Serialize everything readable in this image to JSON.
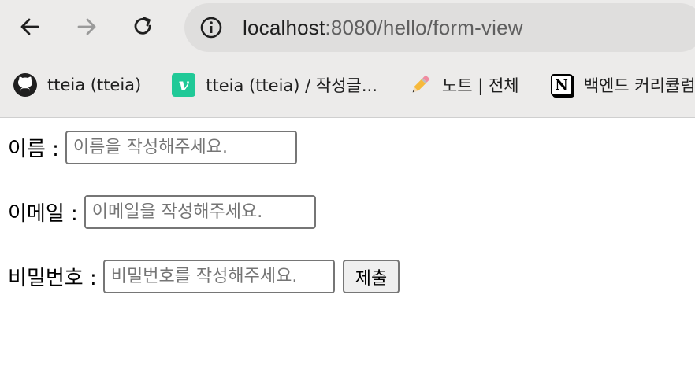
{
  "browser": {
    "url_host": "localhost",
    "url_path": ":8080/hello/form-view",
    "bookmarks": [
      {
        "label": "tteia (tteia)",
        "icon": "github-icon"
      },
      {
        "label": "tteia (tteia) / 작성글...",
        "icon": "velog-icon",
        "icon_text": "v"
      },
      {
        "label": "노트 | 전체",
        "icon": "pencil-icon"
      },
      {
        "label": "백엔드 커리큘럼",
        "icon": "notion-icon",
        "icon_text": "N"
      }
    ]
  },
  "form": {
    "name_label": "이름 :",
    "name_placeholder": "이름을 작성해주세요.",
    "email_label": "이메일 :",
    "email_placeholder": "이메일을 작성해주세요.",
    "password_label": "비밀번호 :",
    "password_placeholder": "비밀번호를 작성해주세요.",
    "submit_label": "제출"
  }
}
